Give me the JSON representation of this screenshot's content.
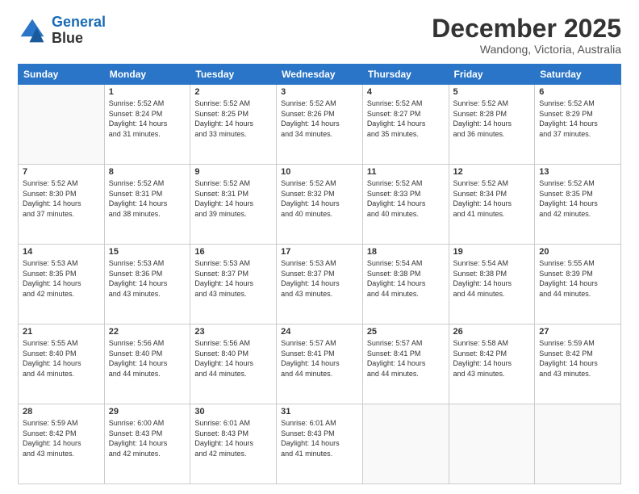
{
  "header": {
    "logo_line1": "General",
    "logo_line2": "Blue",
    "month": "December 2025",
    "location": "Wandong, Victoria, Australia"
  },
  "weekdays": [
    "Sunday",
    "Monday",
    "Tuesday",
    "Wednesday",
    "Thursday",
    "Friday",
    "Saturday"
  ],
  "weeks": [
    [
      {
        "day": "",
        "sunrise": "",
        "sunset": "",
        "daylight": ""
      },
      {
        "day": "1",
        "sunrise": "Sunrise: 5:52 AM",
        "sunset": "Sunset: 8:24 PM",
        "daylight": "Daylight: 14 hours and 31 minutes."
      },
      {
        "day": "2",
        "sunrise": "Sunrise: 5:52 AM",
        "sunset": "Sunset: 8:25 PM",
        "daylight": "Daylight: 14 hours and 33 minutes."
      },
      {
        "day": "3",
        "sunrise": "Sunrise: 5:52 AM",
        "sunset": "Sunset: 8:26 PM",
        "daylight": "Daylight: 14 hours and 34 minutes."
      },
      {
        "day": "4",
        "sunrise": "Sunrise: 5:52 AM",
        "sunset": "Sunset: 8:27 PM",
        "daylight": "Daylight: 14 hours and 35 minutes."
      },
      {
        "day": "5",
        "sunrise": "Sunrise: 5:52 AM",
        "sunset": "Sunset: 8:28 PM",
        "daylight": "Daylight: 14 hours and 36 minutes."
      },
      {
        "day": "6",
        "sunrise": "Sunrise: 5:52 AM",
        "sunset": "Sunset: 8:29 PM",
        "daylight": "Daylight: 14 hours and 37 minutes."
      }
    ],
    [
      {
        "day": "7",
        "sunrise": "Sunrise: 5:52 AM",
        "sunset": "Sunset: 8:30 PM",
        "daylight": "Daylight: 14 hours and 37 minutes."
      },
      {
        "day": "8",
        "sunrise": "Sunrise: 5:52 AM",
        "sunset": "Sunset: 8:31 PM",
        "daylight": "Daylight: 14 hours and 38 minutes."
      },
      {
        "day": "9",
        "sunrise": "Sunrise: 5:52 AM",
        "sunset": "Sunset: 8:31 PM",
        "daylight": "Daylight: 14 hours and 39 minutes."
      },
      {
        "day": "10",
        "sunrise": "Sunrise: 5:52 AM",
        "sunset": "Sunset: 8:32 PM",
        "daylight": "Daylight: 14 hours and 40 minutes."
      },
      {
        "day": "11",
        "sunrise": "Sunrise: 5:52 AM",
        "sunset": "Sunset: 8:33 PM",
        "daylight": "Daylight: 14 hours and 40 minutes."
      },
      {
        "day": "12",
        "sunrise": "Sunrise: 5:52 AM",
        "sunset": "Sunset: 8:34 PM",
        "daylight": "Daylight: 14 hours and 41 minutes."
      },
      {
        "day": "13",
        "sunrise": "Sunrise: 5:52 AM",
        "sunset": "Sunset: 8:35 PM",
        "daylight": "Daylight: 14 hours and 42 minutes."
      }
    ],
    [
      {
        "day": "14",
        "sunrise": "Sunrise: 5:53 AM",
        "sunset": "Sunset: 8:35 PM",
        "daylight": "Daylight: 14 hours and 42 minutes."
      },
      {
        "day": "15",
        "sunrise": "Sunrise: 5:53 AM",
        "sunset": "Sunset: 8:36 PM",
        "daylight": "Daylight: 14 hours and 43 minutes."
      },
      {
        "day": "16",
        "sunrise": "Sunrise: 5:53 AM",
        "sunset": "Sunset: 8:37 PM",
        "daylight": "Daylight: 14 hours and 43 minutes."
      },
      {
        "day": "17",
        "sunrise": "Sunrise: 5:53 AM",
        "sunset": "Sunset: 8:37 PM",
        "daylight": "Daylight: 14 hours and 43 minutes."
      },
      {
        "day": "18",
        "sunrise": "Sunrise: 5:54 AM",
        "sunset": "Sunset: 8:38 PM",
        "daylight": "Daylight: 14 hours and 44 minutes."
      },
      {
        "day": "19",
        "sunrise": "Sunrise: 5:54 AM",
        "sunset": "Sunset: 8:38 PM",
        "daylight": "Daylight: 14 hours and 44 minutes."
      },
      {
        "day": "20",
        "sunrise": "Sunrise: 5:55 AM",
        "sunset": "Sunset: 8:39 PM",
        "daylight": "Daylight: 14 hours and 44 minutes."
      }
    ],
    [
      {
        "day": "21",
        "sunrise": "Sunrise: 5:55 AM",
        "sunset": "Sunset: 8:40 PM",
        "daylight": "Daylight: 14 hours and 44 minutes."
      },
      {
        "day": "22",
        "sunrise": "Sunrise: 5:56 AM",
        "sunset": "Sunset: 8:40 PM",
        "daylight": "Daylight: 14 hours and 44 minutes."
      },
      {
        "day": "23",
        "sunrise": "Sunrise: 5:56 AM",
        "sunset": "Sunset: 8:40 PM",
        "daylight": "Daylight: 14 hours and 44 minutes."
      },
      {
        "day": "24",
        "sunrise": "Sunrise: 5:57 AM",
        "sunset": "Sunset: 8:41 PM",
        "daylight": "Daylight: 14 hours and 44 minutes."
      },
      {
        "day": "25",
        "sunrise": "Sunrise: 5:57 AM",
        "sunset": "Sunset: 8:41 PM",
        "daylight": "Daylight: 14 hours and 44 minutes."
      },
      {
        "day": "26",
        "sunrise": "Sunrise: 5:58 AM",
        "sunset": "Sunset: 8:42 PM",
        "daylight": "Daylight: 14 hours and 43 minutes."
      },
      {
        "day": "27",
        "sunrise": "Sunrise: 5:59 AM",
        "sunset": "Sunset: 8:42 PM",
        "daylight": "Daylight: 14 hours and 43 minutes."
      }
    ],
    [
      {
        "day": "28",
        "sunrise": "Sunrise: 5:59 AM",
        "sunset": "Sunset: 8:42 PM",
        "daylight": "Daylight: 14 hours and 43 minutes."
      },
      {
        "day": "29",
        "sunrise": "Sunrise: 6:00 AM",
        "sunset": "Sunset: 8:43 PM",
        "daylight": "Daylight: 14 hours and 42 minutes."
      },
      {
        "day": "30",
        "sunrise": "Sunrise: 6:01 AM",
        "sunset": "Sunset: 8:43 PM",
        "daylight": "Daylight: 14 hours and 42 minutes."
      },
      {
        "day": "31",
        "sunrise": "Sunrise: 6:01 AM",
        "sunset": "Sunset: 8:43 PM",
        "daylight": "Daylight: 14 hours and 41 minutes."
      },
      {
        "day": "",
        "sunrise": "",
        "sunset": "",
        "daylight": ""
      },
      {
        "day": "",
        "sunrise": "",
        "sunset": "",
        "daylight": ""
      },
      {
        "day": "",
        "sunrise": "",
        "sunset": "",
        "daylight": ""
      }
    ]
  ]
}
